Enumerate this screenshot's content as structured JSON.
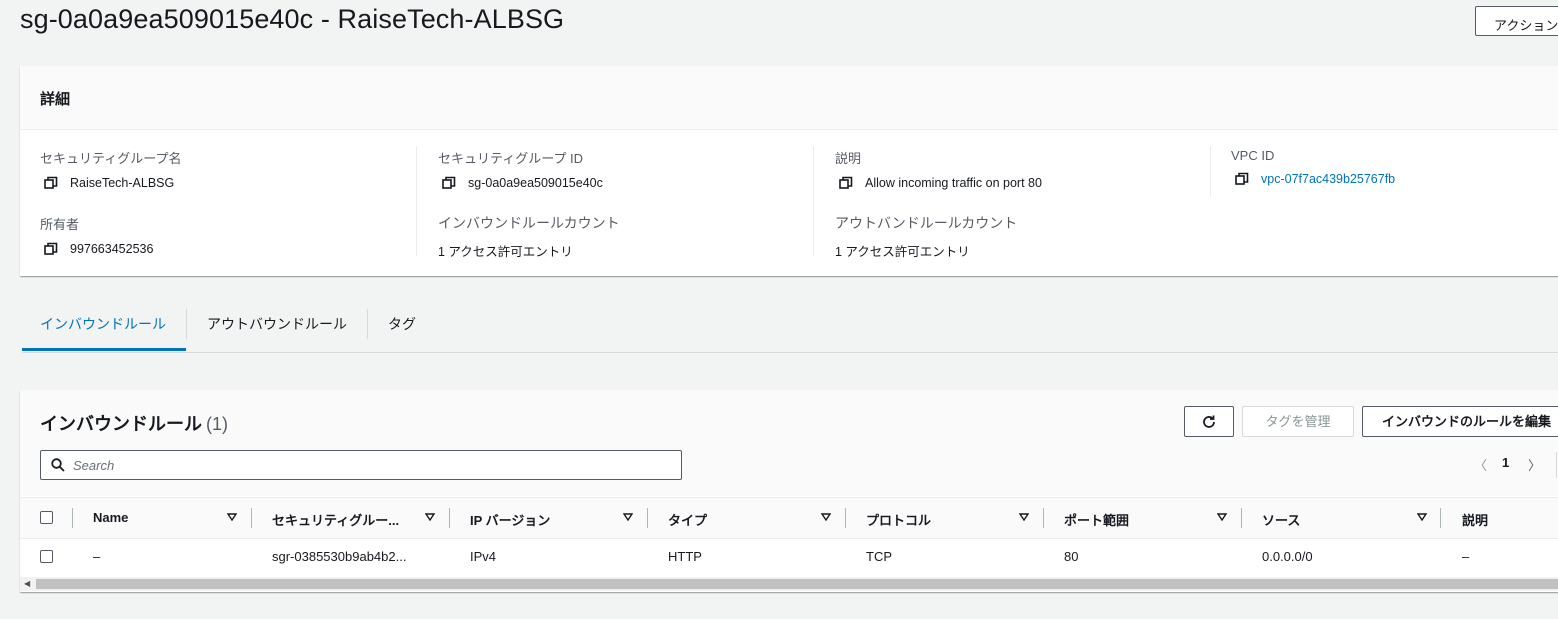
{
  "header": {
    "title": "sg-0a0a9ea509015e40c - RaiseTech-ALBSG",
    "action_label": "アクション"
  },
  "details": {
    "heading": "詳細",
    "fields": {
      "sg_name": {
        "label": "セキュリティグループ名",
        "value": "RaiseTech-ALBSG"
      },
      "sg_id": {
        "label": "セキュリティグループ ID",
        "value": "sg-0a0a9ea509015e40c"
      },
      "description": {
        "label": "説明",
        "value": "Allow incoming traffic on port 80"
      },
      "vpc_id": {
        "label": "VPC ID",
        "value": "vpc-07f7ac439b25767fb"
      },
      "owner": {
        "label": "所有者",
        "value": "997663452536"
      },
      "inbound_count": {
        "label": "インバウンドルールカウント",
        "value": "1 アクセス許可エントリ"
      },
      "outbound_count": {
        "label": "アウトバンドルールカウント",
        "value": "1 アクセス許可エントリ"
      }
    }
  },
  "tabs": {
    "inbound": "インバウンドルール",
    "outbound": "アウトバウンドルール",
    "tags": "タグ",
    "active": "inbound"
  },
  "rules": {
    "title": "インバウンドルール",
    "count": "(1)",
    "manage_tags_label": "タグを管理",
    "edit_rules_label": "インバウンドのルールを編集",
    "search_placeholder": "Search",
    "page": "1",
    "columns": {
      "name": "Name",
      "rule_id": "セキュリティグルー...",
      "ip_version": "IP バージョン",
      "type": "タイプ",
      "protocol": "プロトコル",
      "port_range": "ポート範囲",
      "source": "ソース",
      "description": "説明"
    },
    "rows": [
      {
        "name": "–",
        "rule_id": "sgr-0385530b9ab4b2...",
        "ip_version": "IPv4",
        "type": "HTTP",
        "protocol": "TCP",
        "port_range": "80",
        "source": "0.0.0.0/0",
        "description": "–"
      }
    ]
  },
  "colors": {
    "link": "#0073bb",
    "background": "#f2f3f3"
  }
}
